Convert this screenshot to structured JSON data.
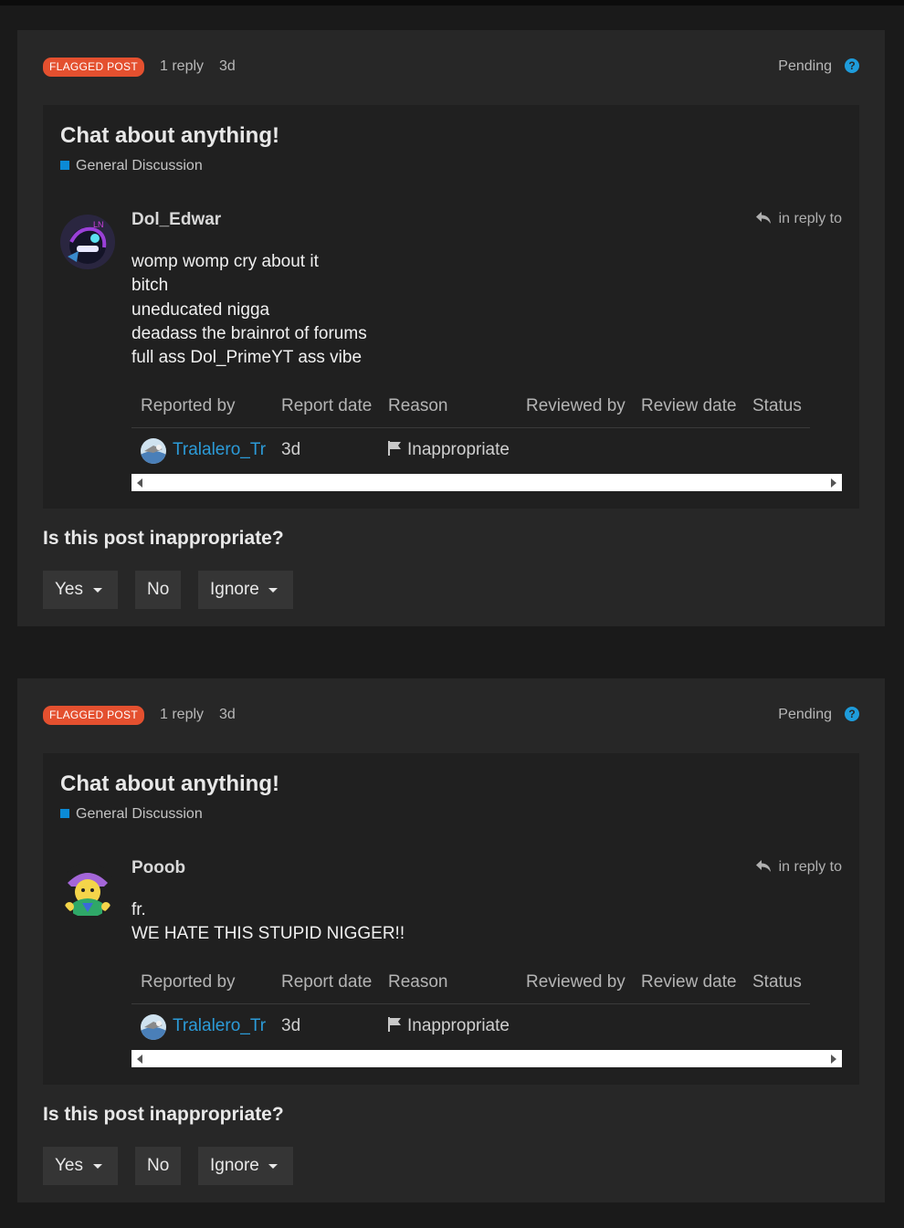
{
  "reviews": [
    {
      "flag_label": "FLAGGED POST",
      "replies": "1 reply",
      "age": "3d",
      "status": "Pending",
      "help_icon": "question-circle-icon",
      "topic_title": "Chat about anything!",
      "category": "General Discussion",
      "category_color": "#0b8ad6",
      "author": "Dol_Edwar",
      "in_reply_to": "in reply to",
      "body_lines": [
        "womp womp cry about it",
        "bitch",
        "uneducated nigga",
        "deadass the brainrot of forums",
        "full ass Dol_PrimeYT ass vibe"
      ],
      "table": {
        "headers": [
          "Reported by",
          "Report date",
          "Reason",
          "Reviewed by",
          "Review date",
          "Status"
        ],
        "row": {
          "reporter": "Tralalero_Tr",
          "date": "3d",
          "reason": "Inappropriate"
        }
      },
      "question": "Is this post inappropriate?",
      "actions": {
        "yes": "Yes",
        "no": "No",
        "ignore": "Ignore"
      }
    },
    {
      "flag_label": "FLAGGED POST",
      "replies": "1 reply",
      "age": "3d",
      "status": "Pending",
      "help_icon": "question-circle-icon",
      "topic_title": "Chat about anything!",
      "category": "General Discussion",
      "category_color": "#0b8ad6",
      "author": "Pooob",
      "in_reply_to": "in reply to",
      "body_lines": [
        "fr.",
        "WE HATE THIS STUPID NIGGER!!"
      ],
      "table": {
        "headers": [
          "Reported by",
          "Report date",
          "Reason",
          "Reviewed by",
          "Review date",
          "Status"
        ],
        "row": {
          "reporter": "Tralalero_Tr",
          "date": "3d",
          "reason": "Inappropriate"
        }
      },
      "question": "Is this post inappropriate?",
      "actions": {
        "yes": "Yes",
        "no": "No",
        "ignore": "Ignore"
      }
    }
  ],
  "colors": {
    "flag_bg": "#e4502f",
    "link": "#2c9bd8",
    "help": "#1e9cdb"
  }
}
